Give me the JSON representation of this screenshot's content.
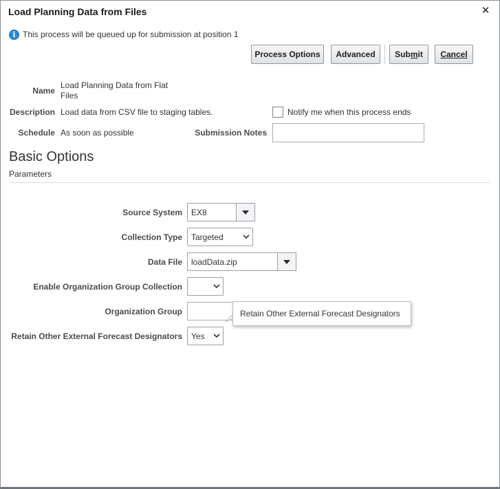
{
  "dialog": {
    "title": "Load Planning Data from Files",
    "close_glyph": "✕"
  },
  "info": {
    "icon": "info-icon",
    "text": "This process will be queued up for submission at position 1"
  },
  "buttons": {
    "process_options": "Process Options",
    "advanced": "Advanced",
    "submit_pre": "Sub",
    "submit_mn": "m",
    "submit_post": "it",
    "cancel": "Cancel"
  },
  "details": {
    "name_label": "Name",
    "name_line1": "Load Planning Data from Flat",
    "name_line2": "Files",
    "description_label": "Description",
    "description_value": "Load data from CSV file to staging tables.",
    "notify_label": "Notify me when this process ends",
    "notify_checked": false,
    "schedule_label": "Schedule",
    "schedule_value": "As soon as possible",
    "submission_notes_label": "Submission Notes",
    "submission_notes_value": ""
  },
  "basic_options": {
    "title": "Basic Options",
    "subtitle": "Parameters"
  },
  "parameters": {
    "source_system_label": "Source System",
    "source_system_value": "EX8",
    "collection_type_label": "Collection Type",
    "collection_type_value": "Targeted",
    "data_file_label": "Data File",
    "data_file_value": "loadData.zip",
    "enable_org_group_label": "Enable Organization Group Collection",
    "enable_org_group_value": "",
    "org_group_label": "Organization Group",
    "org_group_value": "",
    "retain_label": "Retain Other External Forecast Designators",
    "retain_value": "Yes"
  },
  "tooltip": {
    "text": "Retain Other External Forecast Designators"
  }
}
